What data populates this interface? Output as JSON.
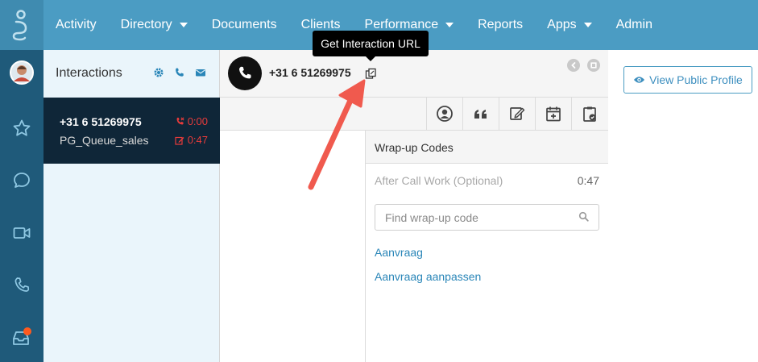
{
  "nav": {
    "items": [
      {
        "label": "Activity",
        "caret": false
      },
      {
        "label": "Directory",
        "caret": true
      },
      {
        "label": "Documents",
        "caret": false
      },
      {
        "label": "Clients",
        "caret": false
      },
      {
        "label": "Performance",
        "caret": true
      },
      {
        "label": "Reports",
        "caret": false
      },
      {
        "label": "Apps",
        "caret": true
      },
      {
        "label": "Admin",
        "caret": false
      }
    ]
  },
  "rail": {
    "icons": [
      "user-avatar",
      "star-icon",
      "chat-icon",
      "video-icon",
      "phone-icon",
      "inbox-icon"
    ],
    "notification_color": "#ff5a1f"
  },
  "interactions": {
    "title": "Interactions",
    "header_icons": [
      "gear-icon",
      "phone-icon",
      "mail-icon"
    ],
    "card": {
      "phone": "+31 6 51269975",
      "queue": "PG_Queue_sales",
      "call_time": "0:00",
      "acw_time": "0:47"
    }
  },
  "detail": {
    "phone": "+31 6 51269975",
    "toolbar_icons": [
      "profile-icon",
      "quote-icon",
      "edit-icon",
      "calendar-add-icon",
      "clipboard-check-icon"
    ]
  },
  "tooltip": {
    "text": "Get Interaction URL"
  },
  "wrapup": {
    "title": "Wrap-up Codes",
    "acw_label": "After Call Work (Optional)",
    "acw_time": "0:47",
    "search_placeholder": "Find wrap-up code",
    "codes": [
      "Aanvraag",
      "Aanvraag aanpassen"
    ]
  },
  "profile": {
    "button_label": "View Public Profile"
  },
  "colors": {
    "nav_bg": "#4b9cc3",
    "rail_bg": "#1f5a7a",
    "card_bg": "#0f2638",
    "alert_red": "#e83b3b",
    "link_blue": "#2a86b8",
    "annotation_arrow": "#f05a4e"
  }
}
